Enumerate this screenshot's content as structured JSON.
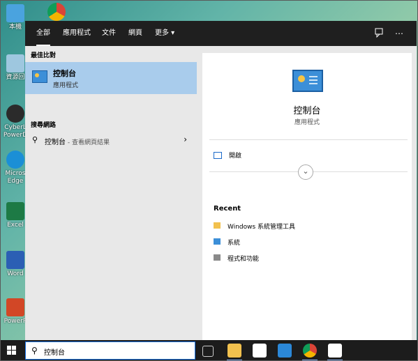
{
  "desktop": {
    "icons": [
      {
        "label": "本機",
        "color": "#4aa3df"
      },
      {
        "label": "資源回",
        "color": "#9ec7df"
      },
      {
        "label": "CyberL PowerD",
        "color": "#2b2b2b"
      },
      {
        "label": "Micros Edge",
        "color": "#1b8fd6"
      },
      {
        "label": "Excel",
        "color": "#1d7a45"
      },
      {
        "label": "Word",
        "color": "#2b5fb4"
      },
      {
        "label": "PowerP",
        "color": "#d24726"
      }
    ]
  },
  "topbar": {
    "tabs": [
      "全部",
      "應用程式",
      "文件",
      "網頁",
      "更多 ▾"
    ],
    "feedback_icon": "feedback-icon",
    "more_icon": "⋯"
  },
  "left": {
    "best_match_label": "最佳比對",
    "best_match": {
      "title": "控制台",
      "subtitle": "應用程式"
    },
    "search_web_label": "搜尋網路",
    "web_result": {
      "text": "控制台",
      "suffix": " - 查看網頁結果"
    }
  },
  "right": {
    "title": "控制台",
    "subtitle": "應用程式",
    "open_label": "開啟",
    "recent_label": "Recent",
    "recent_items": [
      "Windows 系統管理工具",
      "系統",
      "程式和功能"
    ]
  },
  "taskbar": {
    "search_text": "控制台"
  },
  "colors": {
    "accent": "#1a73e8",
    "selection": "#a9ccec",
    "panel_bg": "#e8e8e8",
    "topbar_bg": "#1f1f1f"
  }
}
